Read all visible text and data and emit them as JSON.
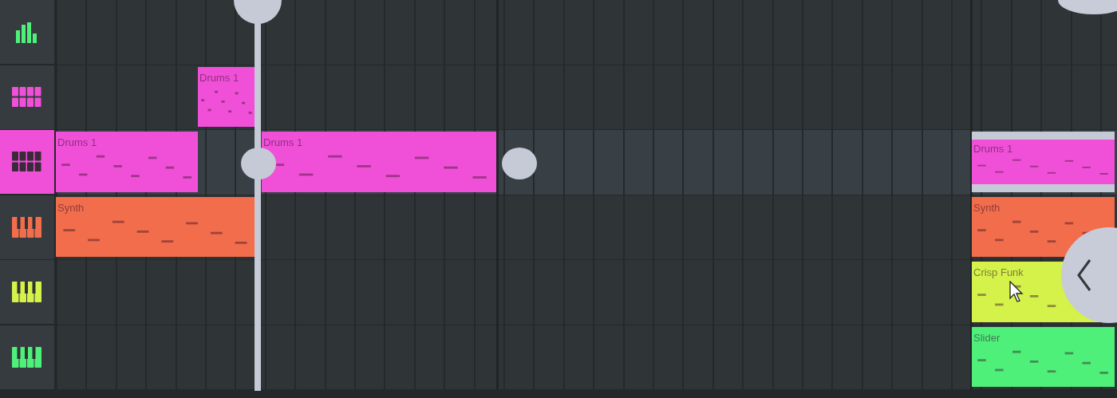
{
  "tracks": [
    {
      "kind": "mixer",
      "color": "#4ef07a",
      "selected": false
    },
    {
      "kind": "pads",
      "color": "#f050d8",
      "selected": false,
      "clips": [
        {
          "label": "Drums 1",
          "color": "#f050d8",
          "selected": false
        }
      ]
    },
    {
      "kind": "pads",
      "color": "#f050d8",
      "selected": true,
      "clips": [
        {
          "label": "Drums 1",
          "color": "#f050d8",
          "selected": false
        },
        {
          "label": "Drums 1",
          "color": "#f050d8",
          "selected": false
        },
        {
          "label": "Drums 1",
          "color": "#f050d8",
          "selected": true
        }
      ]
    },
    {
      "kind": "keys",
      "color": "#f26d4b",
      "selected": false,
      "clips": [
        {
          "label": "Synth",
          "color": "#f26d4b",
          "selected": false
        },
        {
          "label": "Synth",
          "color": "#f26d4b",
          "selected": false
        }
      ]
    },
    {
      "kind": "keys",
      "color": "#d4f24a",
      "selected": false,
      "clips": [
        {
          "label": "Crisp Funk",
          "color": "#d4f24a",
          "selected": false
        }
      ]
    },
    {
      "kind": "keys",
      "color": "#4ef07a",
      "selected": false,
      "clips": [
        {
          "label": "Slider",
          "color": "#4ef07a",
          "selected": false
        }
      ]
    }
  ]
}
